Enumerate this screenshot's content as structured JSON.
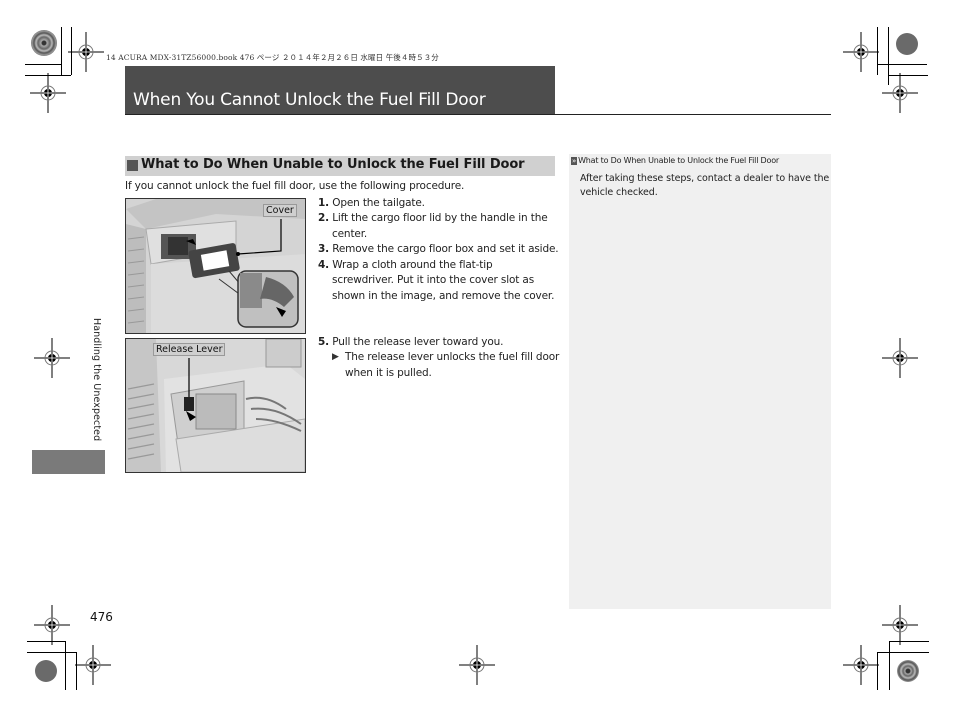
{
  "print_header": {
    "book_line": "14 ACURA MDX-31TZ56000.book  476 ページ  ２０１４年２月２６日  水曜日  午後４時５３分"
  },
  "page": {
    "title": "When You Cannot Unlock the Fuel Fill Door",
    "side_tab_label": "Handling the Unexpected",
    "page_number": "476"
  },
  "section": {
    "heading": "What to Do When Unable to Unlock the Fuel Fill Door",
    "intro": "If you cannot unlock the fuel fill door, use the following procedure.",
    "steps": [
      {
        "num": "1.",
        "lines": [
          "Open the tailgate."
        ]
      },
      {
        "num": "2.",
        "lines": [
          "Lift the cargo floor lid by the handle in the",
          "center."
        ]
      },
      {
        "num": "3.",
        "lines": [
          "Remove the cargo floor box and set it aside."
        ]
      },
      {
        "num": "4.",
        "lines": [
          "Wrap a cloth around the flat-tip",
          "screwdriver. Put it into the cover slot as",
          "shown in the image, and remove the cover."
        ]
      },
      {
        "num": "5.",
        "lines": [
          "Pull the release lever toward you."
        ],
        "sub": {
          "icon": "triangle-right-icon",
          "lines": [
            "The release lever unlocks the fuel fill door",
            "when it is pulled."
          ]
        }
      }
    ],
    "images": [
      {
        "label": "Cover",
        "description": "Cargo area with cover removed from slot, inset showing screwdriver wrapped in cloth"
      },
      {
        "label": "Release Lever",
        "description": "Cargo area side panel with release lever"
      }
    ]
  },
  "sidebar_note": {
    "icon": "double-chevron-icon",
    "title": "What to Do When Unable to Unlock the Fuel Fill Door",
    "text": "After taking these steps, contact a dealer to have the vehicle checked."
  },
  "colors": {
    "title_bar": "#4d4d4d",
    "section_bar": "#d0d0d0",
    "note_bg": "#f0f0f0",
    "tab_block": "#7a7a7a"
  }
}
